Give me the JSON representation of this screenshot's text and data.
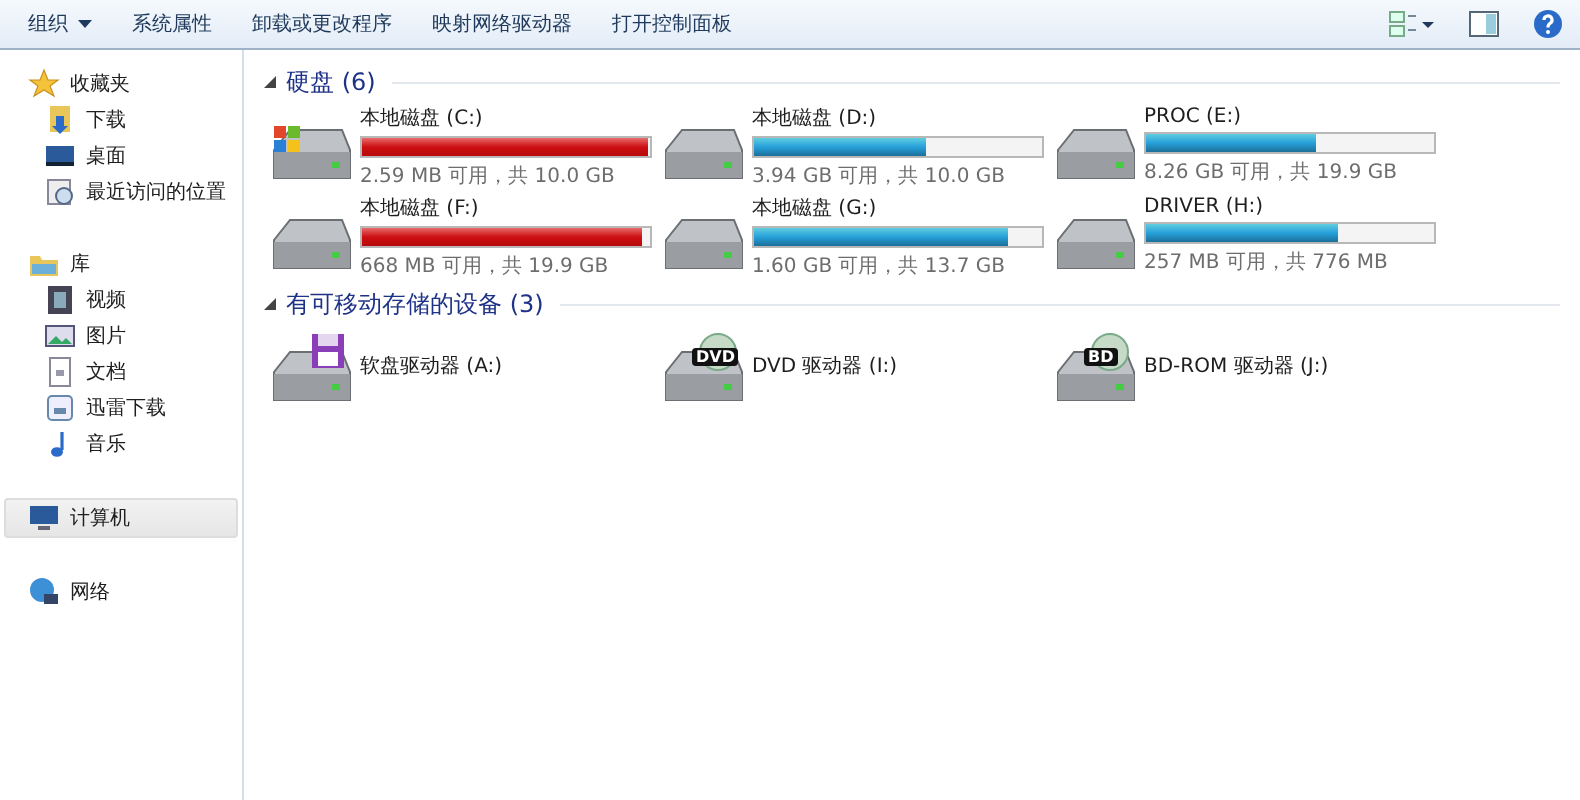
{
  "toolbar": {
    "buttons": [
      {
        "label": "组织",
        "dropdown": true
      },
      {
        "label": "系统属性",
        "dropdown": false
      },
      {
        "label": "卸载或更改程序",
        "dropdown": false
      },
      {
        "label": "映射网络驱动器",
        "dropdown": false
      },
      {
        "label": "打开控制面板",
        "dropdown": false
      }
    ]
  },
  "sidebar": {
    "groups": [
      {
        "label": "收藏夹",
        "kind": "favorites",
        "selected": false,
        "children": [
          {
            "label": "下载",
            "kind": "download"
          },
          {
            "label": "桌面",
            "kind": "desktop"
          },
          {
            "label": "最近访问的位置",
            "kind": "recent"
          }
        ]
      },
      {
        "label": "库",
        "kind": "library",
        "selected": false,
        "children": [
          {
            "label": "视频",
            "kind": "video"
          },
          {
            "label": "图片",
            "kind": "picture"
          },
          {
            "label": "文档",
            "kind": "document"
          },
          {
            "label": "迅雷下载",
            "kind": "download2"
          },
          {
            "label": "音乐",
            "kind": "music"
          }
        ]
      },
      {
        "label": "计算机",
        "kind": "computer",
        "selected": true
      },
      {
        "label": "网络",
        "kind": "network",
        "selected": false
      }
    ]
  },
  "sections": [
    {
      "title": "硬盘 (6)",
      "kind": "drives",
      "items": [
        {
          "name": "本地磁盘 (C:)",
          "kind": "system",
          "level": 0.99,
          "critical": true,
          "info": "2.59 MB 可用，共 10.0 GB"
        },
        {
          "name": "本地磁盘 (D:)",
          "kind": "local",
          "level": 0.6,
          "critical": false,
          "info": "3.94 GB 可用，共 10.0 GB"
        },
        {
          "name": "PROC (E:)",
          "kind": "local",
          "level": 0.59,
          "critical": false,
          "info": "8.26 GB 可用，共 19.9 GB"
        },
        {
          "name": "本地磁盘 (F:)",
          "kind": "local",
          "level": 0.97,
          "critical": true,
          "info": "668 MB 可用，共 19.9 GB"
        },
        {
          "name": "本地磁盘 (G:)",
          "kind": "local",
          "level": 0.88,
          "critical": false,
          "info": "1.60 GB 可用，共 13.7 GB"
        },
        {
          "name": "DRIVER (H:)",
          "kind": "local",
          "level": 0.67,
          "critical": false,
          "info": "257 MB 可用，共 776 MB"
        }
      ]
    },
    {
      "title": "有可移动存储的设备 (3)",
      "kind": "devices",
      "items": [
        {
          "name": "软盘驱动器 (A:)",
          "kind": "floppy"
        },
        {
          "name": "DVD 驱动器 (I:)",
          "kind": "dvd",
          "badge": "DVD"
        },
        {
          "name": "BD-ROM 驱动器 (J:)",
          "kind": "bd",
          "badge": "BD"
        }
      ]
    }
  ]
}
